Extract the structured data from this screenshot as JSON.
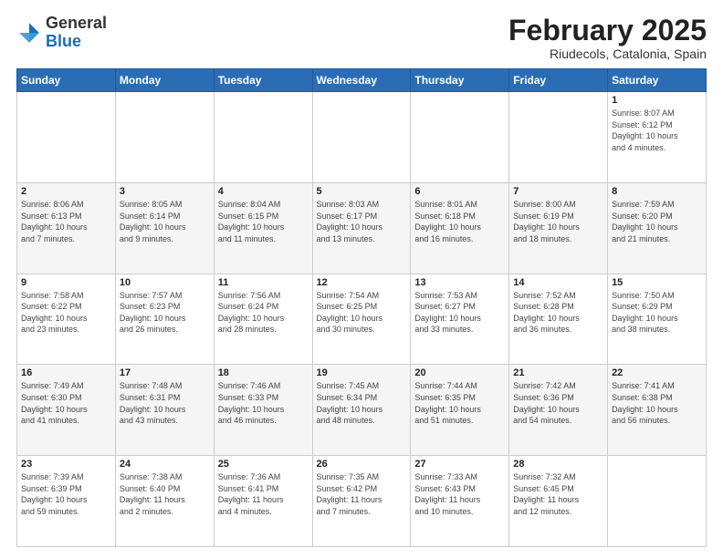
{
  "header": {
    "logo_general": "General",
    "logo_blue": "Blue",
    "month_title": "February 2025",
    "subtitle": "Riudecols, Catalonia, Spain"
  },
  "days_of_week": [
    "Sunday",
    "Monday",
    "Tuesday",
    "Wednesday",
    "Thursday",
    "Friday",
    "Saturday"
  ],
  "weeks": [
    [
      {
        "day": "",
        "info": ""
      },
      {
        "day": "",
        "info": ""
      },
      {
        "day": "",
        "info": ""
      },
      {
        "day": "",
        "info": ""
      },
      {
        "day": "",
        "info": ""
      },
      {
        "day": "",
        "info": ""
      },
      {
        "day": "1",
        "info": "Sunrise: 8:07 AM\nSunset: 6:12 PM\nDaylight: 10 hours\nand 4 minutes."
      }
    ],
    [
      {
        "day": "2",
        "info": "Sunrise: 8:06 AM\nSunset: 6:13 PM\nDaylight: 10 hours\nand 7 minutes."
      },
      {
        "day": "3",
        "info": "Sunrise: 8:05 AM\nSunset: 6:14 PM\nDaylight: 10 hours\nand 9 minutes."
      },
      {
        "day": "4",
        "info": "Sunrise: 8:04 AM\nSunset: 6:15 PM\nDaylight: 10 hours\nand 11 minutes."
      },
      {
        "day": "5",
        "info": "Sunrise: 8:03 AM\nSunset: 6:17 PM\nDaylight: 10 hours\nand 13 minutes."
      },
      {
        "day": "6",
        "info": "Sunrise: 8:01 AM\nSunset: 6:18 PM\nDaylight: 10 hours\nand 16 minutes."
      },
      {
        "day": "7",
        "info": "Sunrise: 8:00 AM\nSunset: 6:19 PM\nDaylight: 10 hours\nand 18 minutes."
      },
      {
        "day": "8",
        "info": "Sunrise: 7:59 AM\nSunset: 6:20 PM\nDaylight: 10 hours\nand 21 minutes."
      }
    ],
    [
      {
        "day": "9",
        "info": "Sunrise: 7:58 AM\nSunset: 6:22 PM\nDaylight: 10 hours\nand 23 minutes."
      },
      {
        "day": "10",
        "info": "Sunrise: 7:57 AM\nSunset: 6:23 PM\nDaylight: 10 hours\nand 26 minutes."
      },
      {
        "day": "11",
        "info": "Sunrise: 7:56 AM\nSunset: 6:24 PM\nDaylight: 10 hours\nand 28 minutes."
      },
      {
        "day": "12",
        "info": "Sunrise: 7:54 AM\nSunset: 6:25 PM\nDaylight: 10 hours\nand 30 minutes."
      },
      {
        "day": "13",
        "info": "Sunrise: 7:53 AM\nSunset: 6:27 PM\nDaylight: 10 hours\nand 33 minutes."
      },
      {
        "day": "14",
        "info": "Sunrise: 7:52 AM\nSunset: 6:28 PM\nDaylight: 10 hours\nand 36 minutes."
      },
      {
        "day": "15",
        "info": "Sunrise: 7:50 AM\nSunset: 6:29 PM\nDaylight: 10 hours\nand 38 minutes."
      }
    ],
    [
      {
        "day": "16",
        "info": "Sunrise: 7:49 AM\nSunset: 6:30 PM\nDaylight: 10 hours\nand 41 minutes."
      },
      {
        "day": "17",
        "info": "Sunrise: 7:48 AM\nSunset: 6:31 PM\nDaylight: 10 hours\nand 43 minutes."
      },
      {
        "day": "18",
        "info": "Sunrise: 7:46 AM\nSunset: 6:33 PM\nDaylight: 10 hours\nand 46 minutes."
      },
      {
        "day": "19",
        "info": "Sunrise: 7:45 AM\nSunset: 6:34 PM\nDaylight: 10 hours\nand 48 minutes."
      },
      {
        "day": "20",
        "info": "Sunrise: 7:44 AM\nSunset: 6:35 PM\nDaylight: 10 hours\nand 51 minutes."
      },
      {
        "day": "21",
        "info": "Sunrise: 7:42 AM\nSunset: 6:36 PM\nDaylight: 10 hours\nand 54 minutes."
      },
      {
        "day": "22",
        "info": "Sunrise: 7:41 AM\nSunset: 6:38 PM\nDaylight: 10 hours\nand 56 minutes."
      }
    ],
    [
      {
        "day": "23",
        "info": "Sunrise: 7:39 AM\nSunset: 6:39 PM\nDaylight: 10 hours\nand 59 minutes."
      },
      {
        "day": "24",
        "info": "Sunrise: 7:38 AM\nSunset: 6:40 PM\nDaylight: 11 hours\nand 2 minutes."
      },
      {
        "day": "25",
        "info": "Sunrise: 7:36 AM\nSunset: 6:41 PM\nDaylight: 11 hours\nand 4 minutes."
      },
      {
        "day": "26",
        "info": "Sunrise: 7:35 AM\nSunset: 6:42 PM\nDaylight: 11 hours\nand 7 minutes."
      },
      {
        "day": "27",
        "info": "Sunrise: 7:33 AM\nSunset: 6:43 PM\nDaylight: 11 hours\nand 10 minutes."
      },
      {
        "day": "28",
        "info": "Sunrise: 7:32 AM\nSunset: 6:45 PM\nDaylight: 11 hours\nand 12 minutes."
      },
      {
        "day": "",
        "info": ""
      }
    ]
  ]
}
